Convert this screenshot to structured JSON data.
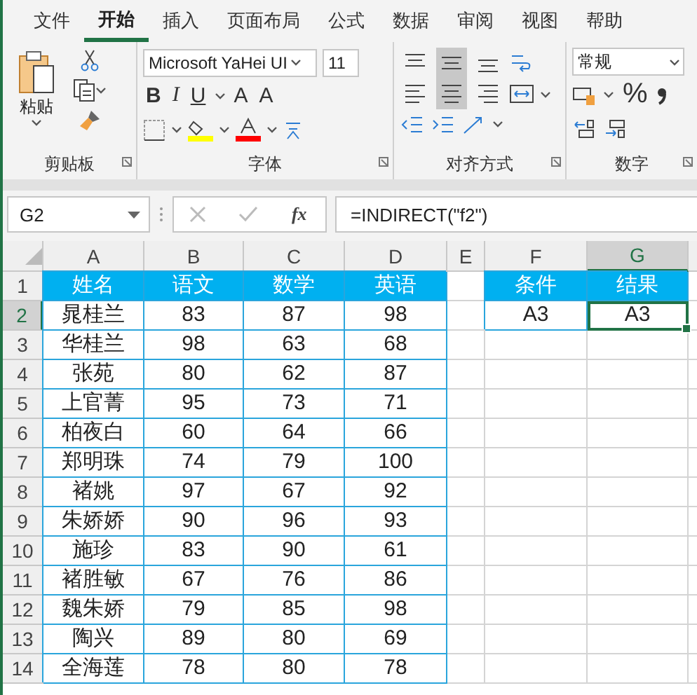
{
  "tabs": [
    {
      "label": "文件",
      "selected": false
    },
    {
      "label": "开始",
      "selected": true
    },
    {
      "label": "插入",
      "selected": false
    },
    {
      "label": "页面布局",
      "selected": false
    },
    {
      "label": "公式",
      "selected": false
    },
    {
      "label": "数据",
      "selected": false
    },
    {
      "label": "审阅",
      "selected": false
    },
    {
      "label": "视图",
      "selected": false
    },
    {
      "label": "帮助",
      "selected": false
    }
  ],
  "ribbon": {
    "clipboard": {
      "title": "剪贴板",
      "paste_label": "粘贴"
    },
    "font": {
      "title": "字体",
      "font_name": "Microsoft YaHei UI",
      "font_size": "11",
      "bold": "B",
      "italic": "I",
      "underline": "U",
      "grow": "A",
      "shrink": "A"
    },
    "alignment": {
      "title": "对齐方式",
      "align_buttons": [
        {
          "kind": "top",
          "selected": false
        },
        {
          "kind": "middle",
          "selected": true
        },
        {
          "kind": "bottom",
          "selected": false
        },
        {
          "kind": "left",
          "selected": false
        },
        {
          "kind": "center",
          "selected": true
        },
        {
          "kind": "right",
          "selected": false
        }
      ]
    },
    "number": {
      "title": "数字",
      "format": "常规",
      "percent": "%"
    }
  },
  "formula_bar": {
    "name_box": "G2",
    "fx": "fx",
    "formula": "=INDIRECT(\"f2\")"
  },
  "sheet": {
    "columns": [
      {
        "label": "A",
        "selected": false
      },
      {
        "label": "B",
        "selected": false
      },
      {
        "label": "C",
        "selected": false
      },
      {
        "label": "D",
        "selected": false
      },
      {
        "label": "E",
        "selected": false
      },
      {
        "label": "F",
        "selected": false
      },
      {
        "label": "G",
        "selected": true
      }
    ],
    "rows": [
      {
        "number": "1",
        "selected": false,
        "kind": "header",
        "cells": {
          "A": "姓名",
          "B": "语文",
          "C": "数学",
          "D": "英语",
          "F": "条件",
          "G": "结果"
        }
      },
      {
        "number": "2",
        "selected": true,
        "kind": "data",
        "cells": {
          "A": "晁桂兰",
          "B": "83",
          "C": "87",
          "D": "98",
          "F": "A3",
          "G": "A3"
        }
      },
      {
        "number": "3",
        "selected": false,
        "kind": "data",
        "cells": {
          "A": "华桂兰",
          "B": "98",
          "C": "63",
          "D": "68"
        }
      },
      {
        "number": "4",
        "selected": false,
        "kind": "data",
        "cells": {
          "A": "张苑",
          "B": "80",
          "C": "62",
          "D": "87"
        }
      },
      {
        "number": "5",
        "selected": false,
        "kind": "data",
        "cells": {
          "A": "上官菁",
          "B": "95",
          "C": "73",
          "D": "71"
        }
      },
      {
        "number": "6",
        "selected": false,
        "kind": "data",
        "cells": {
          "A": "柏夜白",
          "B": "60",
          "C": "64",
          "D": "66"
        }
      },
      {
        "number": "7",
        "selected": false,
        "kind": "data",
        "cells": {
          "A": "郑明珠",
          "B": "74",
          "C": "79",
          "D": "100"
        }
      },
      {
        "number": "8",
        "selected": false,
        "kind": "data",
        "cells": {
          "A": "褚姚",
          "B": "97",
          "C": "67",
          "D": "92"
        }
      },
      {
        "number": "9",
        "selected": false,
        "kind": "data",
        "cells": {
          "A": "朱娇娇",
          "B": "90",
          "C": "96",
          "D": "93"
        }
      },
      {
        "number": "10",
        "selected": false,
        "kind": "data",
        "cells": {
          "A": "施珍",
          "B": "83",
          "C": "90",
          "D": "61"
        }
      },
      {
        "number": "11",
        "selected": false,
        "kind": "data",
        "cells": {
          "A": "褚胜敏",
          "B": "67",
          "C": "76",
          "D": "86"
        }
      },
      {
        "number": "12",
        "selected": false,
        "kind": "data",
        "cells": {
          "A": "魏朱娇",
          "B": "79",
          "C": "85",
          "D": "98"
        }
      },
      {
        "number": "13",
        "selected": false,
        "kind": "data",
        "cells": {
          "A": "陶兴",
          "B": "89",
          "C": "80",
          "D": "69"
        }
      },
      {
        "number": "14",
        "selected": false,
        "kind": "data",
        "cells": {
          "A": "全海莲",
          "B": "78",
          "C": "80",
          "D": "78"
        }
      }
    ]
  }
}
